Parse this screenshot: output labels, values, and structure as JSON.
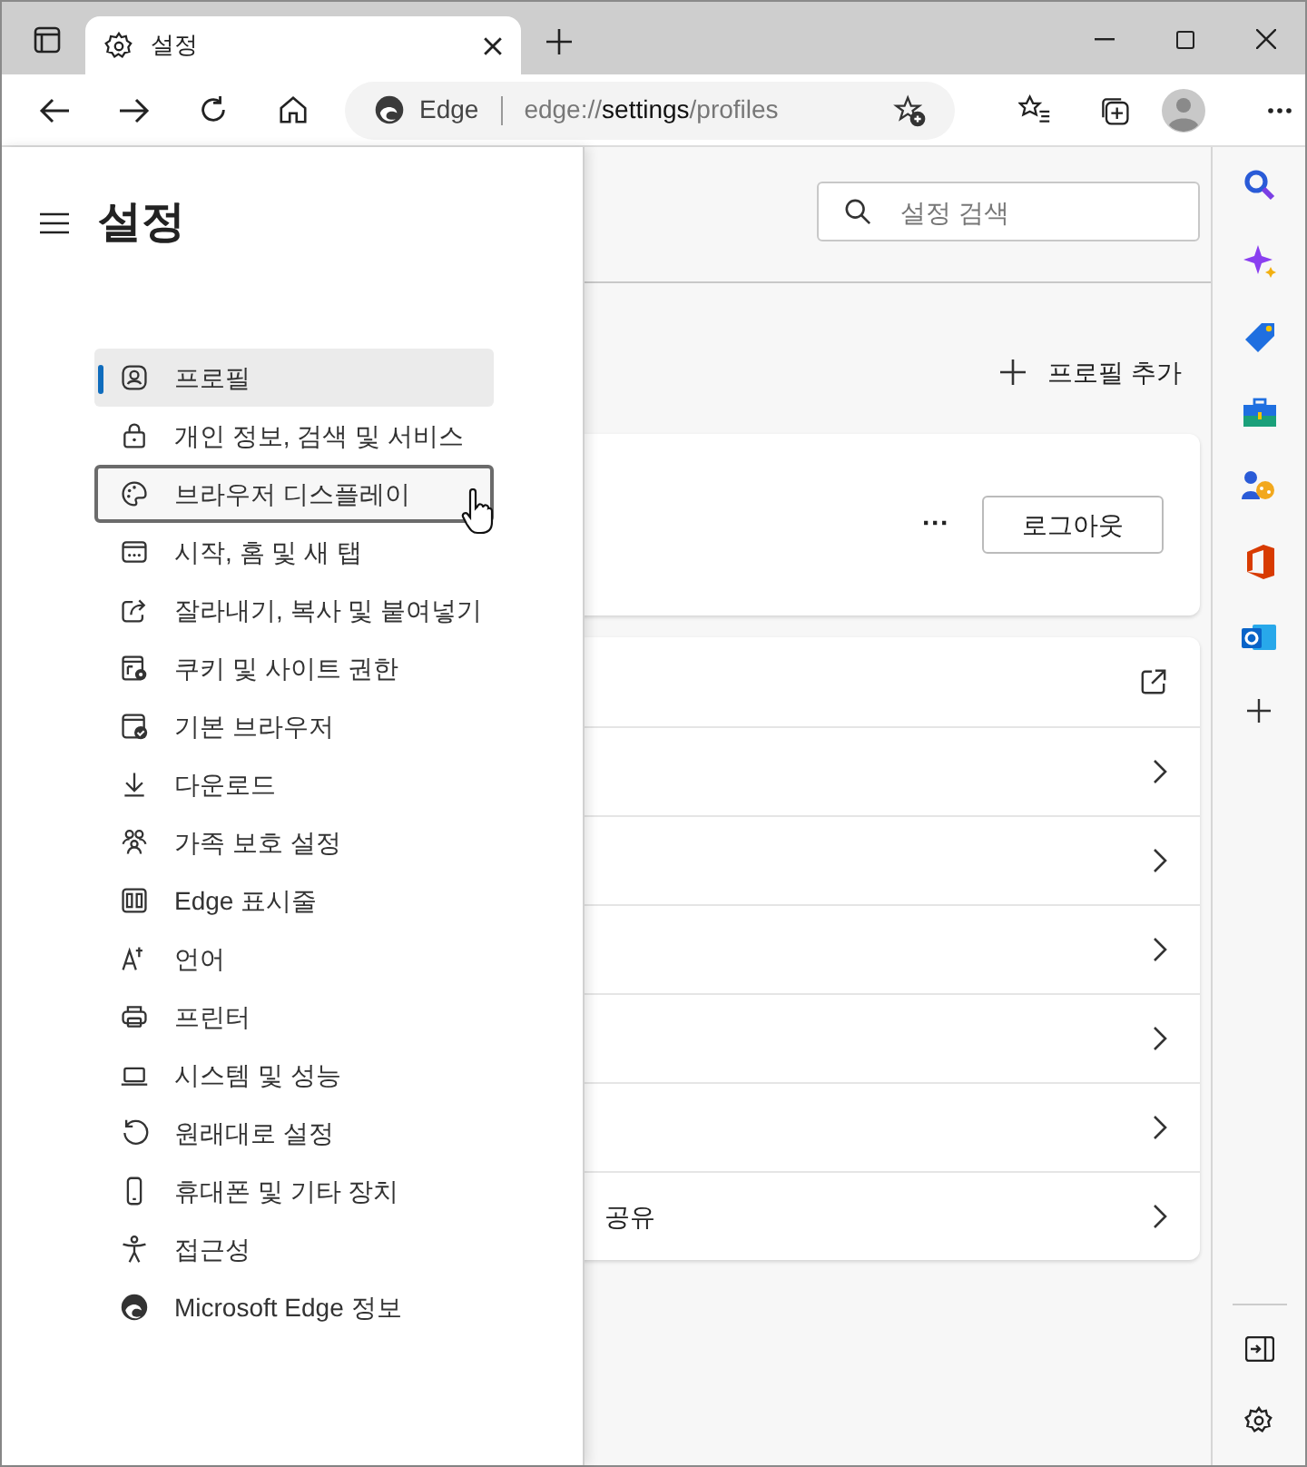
{
  "tab": {
    "title": "설정",
    "selected": true
  },
  "address_bar": {
    "site_label": "Edge",
    "url_parts": [
      {
        "text": "edge://",
        "emphasis": false
      },
      {
        "text": "settings",
        "emphasis": true
      },
      {
        "text": "/profiles",
        "emphasis": false
      }
    ]
  },
  "drawer": {
    "title": "설정",
    "items": [
      {
        "label": "프로필",
        "selected": true,
        "focused": false
      },
      {
        "label": "개인 정보, 검색 및 서비스",
        "selected": false,
        "focused": false
      },
      {
        "label": "브라우저 디스플레이",
        "selected": false,
        "focused": true
      },
      {
        "label": "시작, 홈 및 새 탭",
        "selected": false,
        "focused": false
      },
      {
        "label": "잘라내기, 복사 및 붙여넣기",
        "selected": false,
        "focused": false
      },
      {
        "label": "쿠키 및 사이트 권한",
        "selected": false,
        "focused": false
      },
      {
        "label": "기본 브라우저",
        "selected": false,
        "focused": false
      },
      {
        "label": "다운로드",
        "selected": false,
        "focused": false
      },
      {
        "label": "가족 보호 설정",
        "selected": false,
        "focused": false
      },
      {
        "label": "Edge 표시줄",
        "selected": false,
        "focused": false
      },
      {
        "label": "언어",
        "selected": false,
        "focused": false
      },
      {
        "label": "프린터",
        "selected": false,
        "focused": false
      },
      {
        "label": "시스템 및 성능",
        "selected": false,
        "focused": false
      },
      {
        "label": "원래대로 설정",
        "selected": false,
        "focused": false
      },
      {
        "label": "휴대폰 및 기타 장치",
        "selected": false,
        "focused": false
      },
      {
        "label": "접근성",
        "selected": false,
        "focused": false
      },
      {
        "label": "Microsoft Edge 정보",
        "selected": false,
        "focused": false
      }
    ]
  },
  "search": {
    "placeholder": "설정 검색"
  },
  "add_profile": {
    "label": "프로필 추가"
  },
  "profile_card": {
    "more": "···",
    "sign_out": "로그아웃"
  },
  "settings_rows": [
    {
      "kind": "external",
      "label_tail": ""
    },
    {
      "kind": "chevron",
      "label_tail": ""
    },
    {
      "kind": "chevron",
      "label_tail": ""
    },
    {
      "kind": "chevron",
      "label_tail": ""
    },
    {
      "kind": "chevron",
      "label_tail": ""
    },
    {
      "kind": "chevron",
      "label_tail": ""
    },
    {
      "kind": "chevron",
      "label_tail": "공유"
    }
  ]
}
